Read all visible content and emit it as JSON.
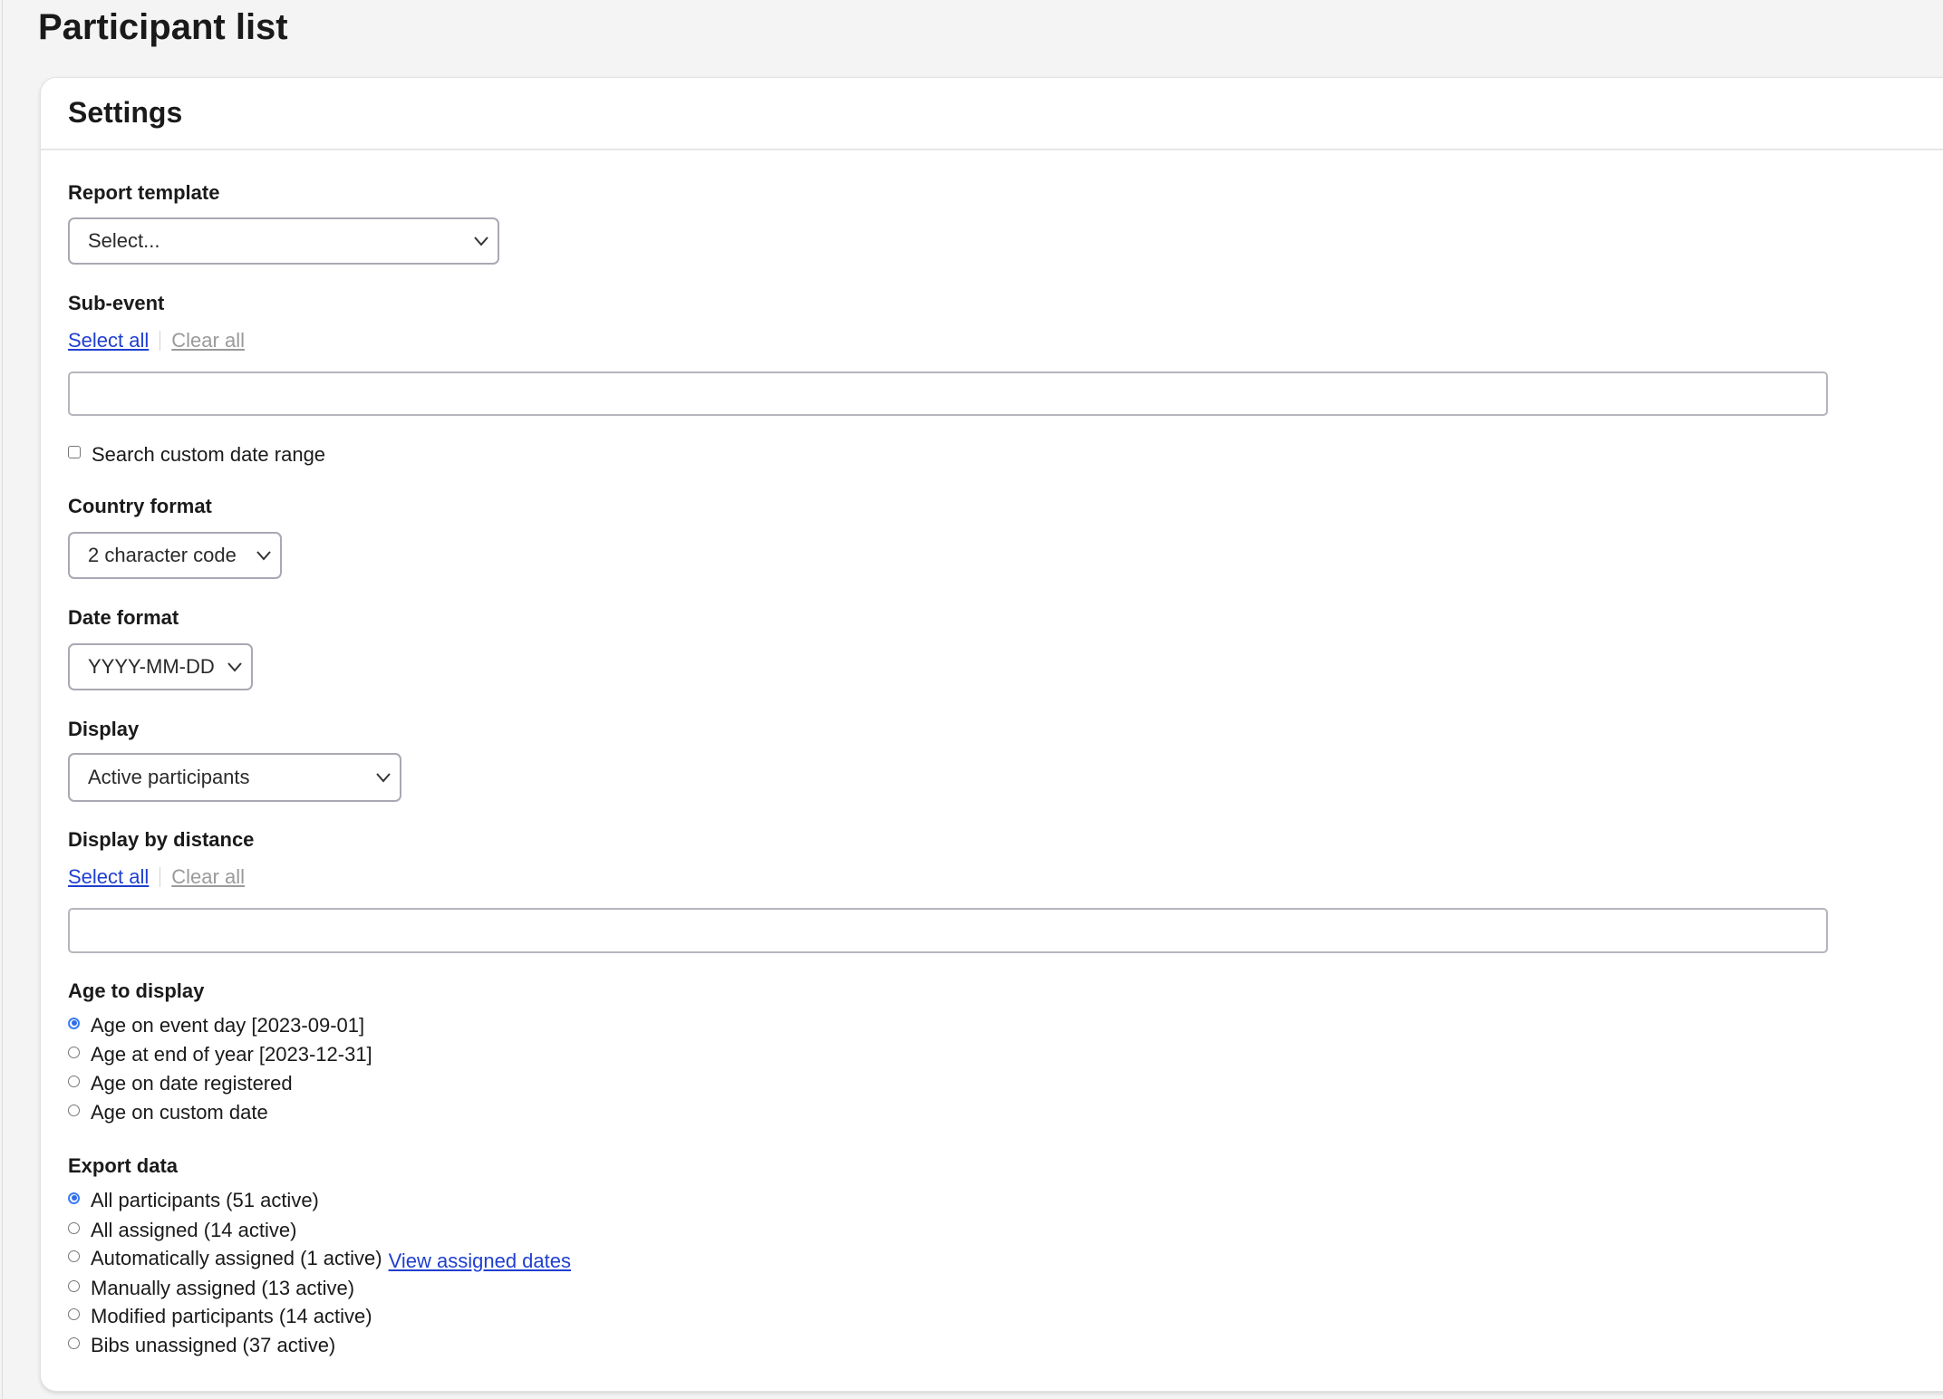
{
  "page_title": "Participant list",
  "card_title": "Settings",
  "report_template": {
    "label": "Report template",
    "value": "Select..."
  },
  "sub_event": {
    "label": "Sub-event",
    "select_all": "Select all",
    "clear_all": "Clear all",
    "value": ""
  },
  "custom_date_range": {
    "label": "Search custom date range",
    "checked": false
  },
  "country_format": {
    "label": "Country format",
    "value": "2 character code"
  },
  "date_format": {
    "label": "Date format",
    "value": "YYYY-MM-DD"
  },
  "display": {
    "label": "Display",
    "value": "Active participants"
  },
  "display_by_distance": {
    "label": "Display by distance",
    "select_all": "Select all",
    "clear_all": "Clear all",
    "value": ""
  },
  "age_to_display": {
    "label": "Age to display",
    "options": [
      {
        "label": "Age on event day [2023-09-01]",
        "selected": true
      },
      {
        "label": "Age at end of year [2023-12-31]",
        "selected": false
      },
      {
        "label": "Age on date registered",
        "selected": false
      },
      {
        "label": "Age on custom date",
        "selected": false
      }
    ]
  },
  "export_data": {
    "label": "Export data",
    "view_assigned_dates": "View assigned dates",
    "options": [
      {
        "label": "All participants (51 active)",
        "selected": true
      },
      {
        "label": "All assigned (14 active)",
        "selected": false
      },
      {
        "label": "Automatically assigned (1 active)",
        "selected": false
      },
      {
        "label": "Manually assigned (13 active)",
        "selected": false
      },
      {
        "label": "Modified participants (14 active)",
        "selected": false
      },
      {
        "label": "Bibs unassigned (37 active)",
        "selected": false
      }
    ]
  },
  "colors": {
    "link": "#1f3fcf",
    "radio_selected": "#2f6de8",
    "muted_link": "#9a9a9a"
  }
}
